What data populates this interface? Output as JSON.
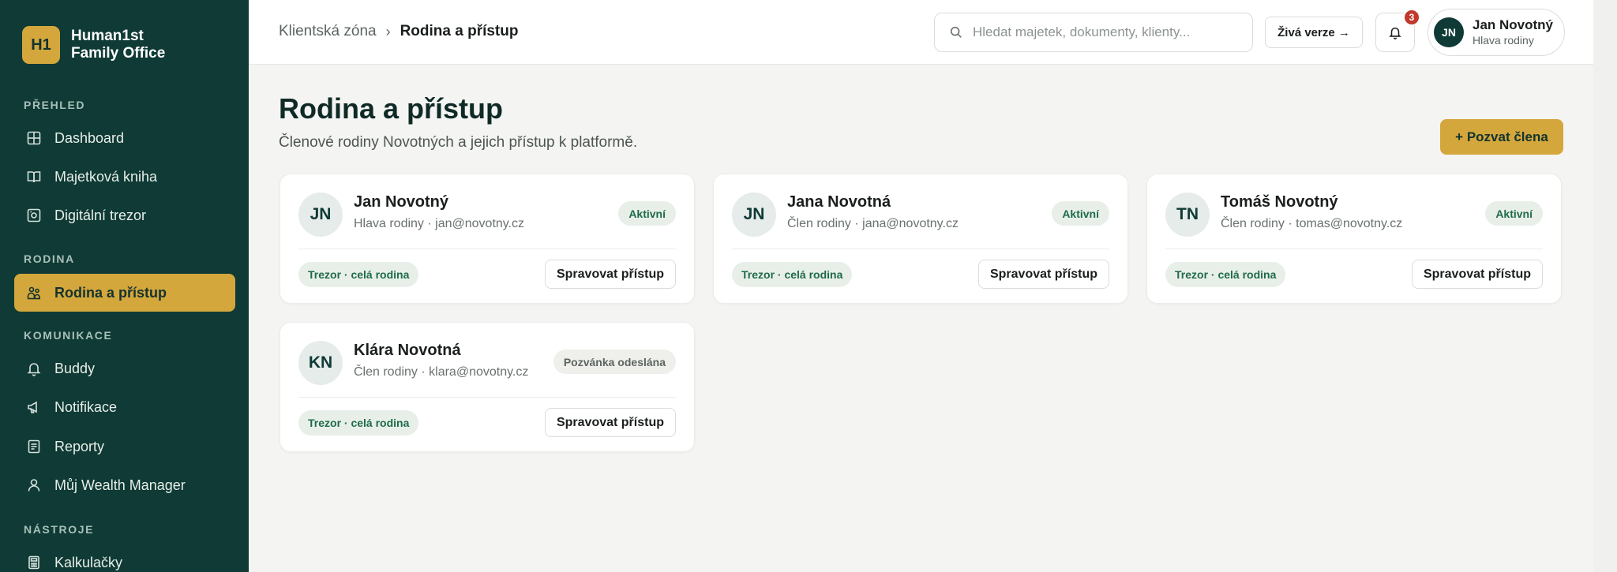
{
  "brand": {
    "logo": "H1",
    "name_line1": "Human1st",
    "name_line2": "Family Office"
  },
  "sidebar": {
    "sections": [
      {
        "title": "PŘEHLED",
        "items": [
          {
            "label": "Dashboard",
            "icon": "dashboard-icon"
          },
          {
            "label": "Majetková kniha",
            "icon": "book-icon"
          },
          {
            "label": "Digitální trezor",
            "icon": "safe-icon"
          }
        ]
      },
      {
        "title": "RODINA",
        "items": [
          {
            "label": "Rodina a přístup",
            "icon": "family-icon",
            "active": true
          }
        ]
      },
      {
        "title": "KOMUNIKACE",
        "items": [
          {
            "label": "Buddy",
            "icon": "bell-icon"
          },
          {
            "label": "Notifikace",
            "icon": "megaphone-icon"
          },
          {
            "label": "Reporty",
            "icon": "report-icon"
          },
          {
            "label": "Můj Wealth Manager",
            "icon": "user-icon"
          }
        ]
      },
      {
        "title": "NÁSTROJE",
        "items": [
          {
            "label": "Kalkulačky",
            "icon": "calculator-icon"
          }
        ]
      }
    ]
  },
  "topbar": {
    "breadcrumb_root": "Klientská zóna",
    "breadcrumb_sep": "›",
    "breadcrumb_current": "Rodina a přístup",
    "search_placeholder": "Hledat majetek, dokumenty, klienty...",
    "live_label": "Živá verze →",
    "notifications_count": "3",
    "user": {
      "initials": "JN",
      "name": "Jan Novotný",
      "role": "Hlava rodiny"
    }
  },
  "page": {
    "title": "Rodina a přístup",
    "subtitle": "Členové rodiny Novotných a jejich přístup k platformě.",
    "invite_label": "+ Pozvat člena"
  },
  "members": [
    {
      "initials": "JN",
      "name": "Jan Novotný",
      "meta": "Hlava rodiny · jan@novotny.cz",
      "status": "Aktivní",
      "status_type": "active",
      "scope": "Trezor · celá rodina",
      "manage": "Spravovat přístup"
    },
    {
      "initials": "JN",
      "name": "Jana Novotná",
      "meta": "Člen rodiny · jana@novotny.cz",
      "status": "Aktivní",
      "status_type": "active",
      "scope": "Trezor · celá rodina",
      "manage": "Spravovat přístup"
    },
    {
      "initials": "TN",
      "name": "Tomáš Novotný",
      "meta": "Člen rodiny · tomas@novotny.cz",
      "status": "Aktivní",
      "status_type": "active",
      "scope": "Trezor · celá rodina",
      "manage": "Spravovat přístup"
    },
    {
      "initials": "KN",
      "name": "Klára Novotná",
      "meta": "Člen rodiny · klara@novotny.cz",
      "status": "Pozvánka odeslána",
      "status_type": "pending",
      "scope": "Trezor · celá rodina",
      "manage": "Spravovat přístup"
    }
  ]
}
